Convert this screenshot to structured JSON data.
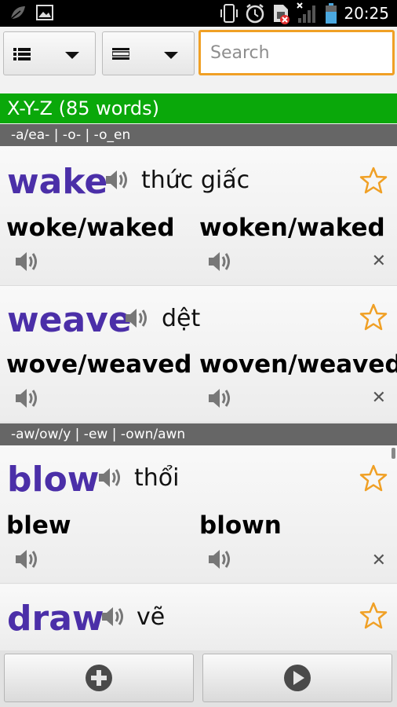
{
  "status_bar": {
    "time": "20:25",
    "icons": [
      "leaf-icon",
      "image-icon",
      "phone-vibrate-icon",
      "alarm-icon",
      "no-sim-icon",
      "no-signal-icon",
      "battery-icon"
    ]
  },
  "toolbar": {
    "list_dropdown_icon": "list-icon",
    "filter_dropdown_icon": "filter-icon",
    "search_placeholder": "Search"
  },
  "list": {
    "header": "X-Y-Z (85 words)",
    "sections": [
      {
        "title": "-a/ea- | -o- | -o_en",
        "entries": [
          {
            "word": "wake",
            "meaning": "thức giấc",
            "past": "woke/waked",
            "participle": "woken/waked"
          },
          {
            "word": "weave",
            "meaning": "dệt",
            "past": "wove/weaved",
            "participle": "woven/weaved"
          }
        ]
      },
      {
        "title": "-aw/ow/y | -ew | -own/awn",
        "entries": [
          {
            "word": "blow",
            "meaning": "thổi",
            "past": "blew",
            "participle": "blown"
          },
          {
            "word": "draw",
            "meaning": "vẽ",
            "past": "",
            "participle": ""
          }
        ]
      }
    ]
  },
  "bottom_bar": {
    "left_icon": "add-icon",
    "right_icon": "play-icon"
  },
  "colors": {
    "header_bg": "#0aa80a",
    "section_bg": "#666666",
    "word": "#4b2fa8",
    "search_border": "#f0a025",
    "star": "#f0a025"
  }
}
